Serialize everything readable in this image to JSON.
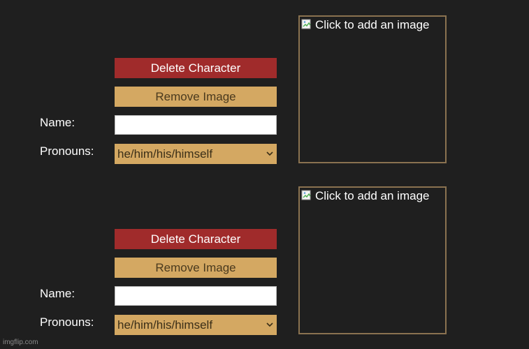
{
  "characters": [
    {
      "delete_label": "Delete Character",
      "remove_image_label": "Remove Image",
      "name_label": "Name:",
      "name_value": "",
      "pronouns_label": "Pronouns:",
      "pronouns_value": "he/him/his/himself",
      "image_alt": "Click to add an image"
    },
    {
      "delete_label": "Delete Character",
      "remove_image_label": "Remove Image",
      "name_label": "Name:",
      "name_value": "",
      "pronouns_label": "Pronouns:",
      "pronouns_value": "he/him/his/himself",
      "image_alt": "Click to add an image"
    }
  ],
  "watermark": "imgflip.com",
  "colors": {
    "background": "#1f1f1f",
    "delete_button": "#a02b2b",
    "gold_button": "#d4a862",
    "image_border": "#8a7250"
  },
  "icons": {
    "select_chevron": "chevron-down-icon",
    "broken_image": "broken-image-icon"
  }
}
